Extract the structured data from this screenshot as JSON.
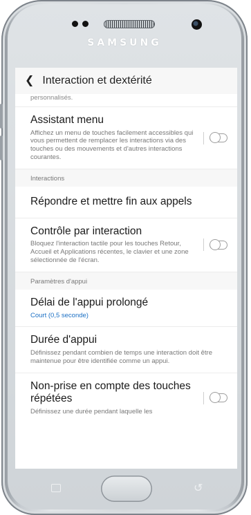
{
  "device": {
    "brand": "SAMSUNG"
  },
  "app_bar": {
    "title": "Interaction et dextérité"
  },
  "top_fragment": "personnalisés.",
  "items": [
    {
      "title": "Assistant menu",
      "desc": "Affichez un menu de touches facilement accessibles qui vous permettent de remplacer les interactions via des touches ou des mouvements et d'autres interactions courantes.",
      "toggle": false
    },
    {
      "section": "Interactions"
    },
    {
      "title": "Répondre et mettre fin aux appels"
    },
    {
      "title": "Contrôle par interaction",
      "desc": "Bloquez l'interaction tactile pour les touches Retour, Accueil et Applications récentes, le clavier et une zone sélectionnée de l'écran.",
      "toggle": false
    },
    {
      "section": "Paramètres d'appui"
    },
    {
      "title": "Délai de l'appui prolongé",
      "value": "Court (0,5 seconde)"
    },
    {
      "title": "Durée d'appui",
      "desc": "Définissez pendant combien de temps une interaction doit être maintenue pour être identifiée comme un appui."
    },
    {
      "title": "Non-prise en compte des touches répétées",
      "desc": "Définissez une durée pendant laquelle les",
      "toggle": false
    }
  ],
  "colors": {
    "accent": "#1a6fc4",
    "toggle_off": "#9e9e9e",
    "section_bg": "#f7f7f7"
  }
}
